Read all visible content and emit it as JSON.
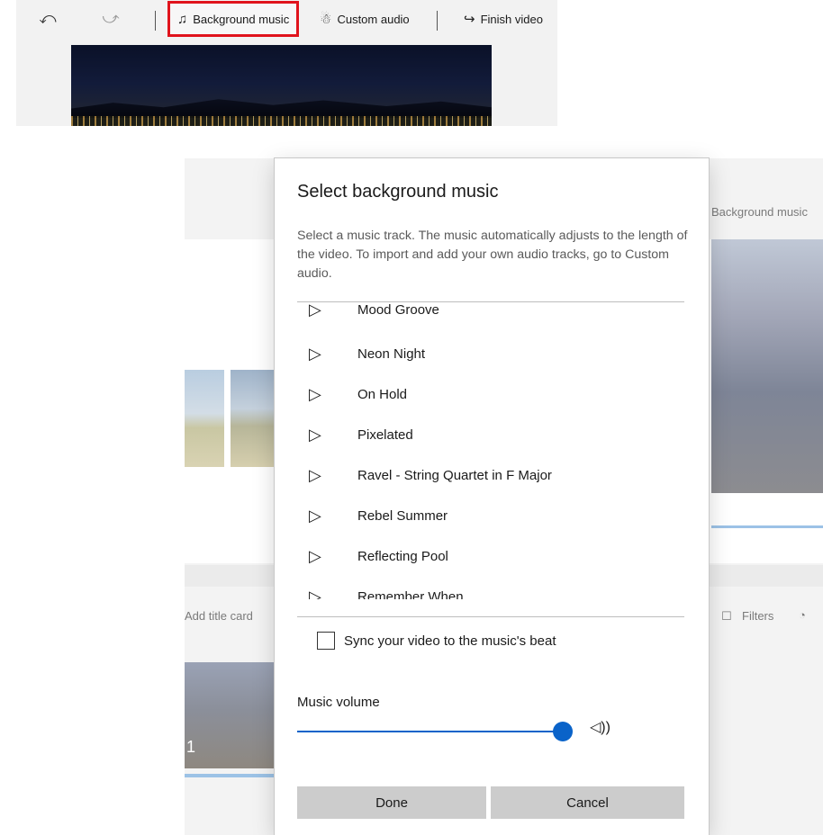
{
  "toolbar": {
    "undo_icon": "undo-icon",
    "redo_icon": "redo-icon",
    "background_music_label": "Background music",
    "custom_audio_label": "Custom audio",
    "finish_video_label": "Finish video"
  },
  "background": {
    "background_music_label": "Background music",
    "add_title_card_label": "Add title card",
    "filters_label": "Filters",
    "clip_number": "1"
  },
  "dialog": {
    "title": "Select background music",
    "description": "Select a music track. The music automatically adjusts to the length of the video. To import and add your own audio tracks, go to Custom audio.",
    "tracks": [
      {
        "title": "Mood Groove"
      },
      {
        "title": "Neon Night"
      },
      {
        "title": "On Hold"
      },
      {
        "title": "Pixelated"
      },
      {
        "title": "Ravel - String Quartet in F Major"
      },
      {
        "title": "Rebel Summer"
      },
      {
        "title": "Reflecting Pool"
      },
      {
        "title": "Remember When"
      }
    ],
    "sync_label": "Sync your video to the music's beat",
    "sync_checked": false,
    "volume_label": "Music volume",
    "volume_level": 1.0,
    "done_label": "Done",
    "cancel_label": "Cancel"
  },
  "colors": {
    "accent": "#0a63c9",
    "highlight_outline": "#e0131c"
  }
}
